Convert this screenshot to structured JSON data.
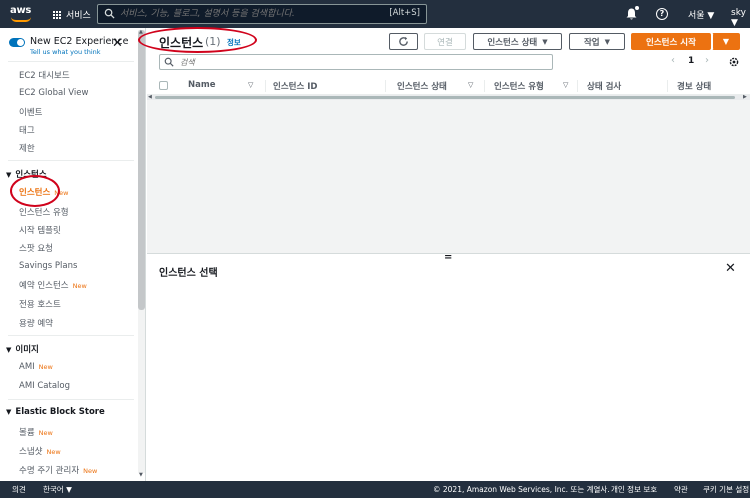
{
  "topnav": {
    "logo": "aws",
    "services_label": "서비스",
    "search_placeholder": "서비스, 기능, 블로그, 설명서 등을 검색합니다.",
    "search_shortcut": "[Alt+S]",
    "help_label": "?",
    "region": "서울 ▼",
    "user": "sky ▼"
  },
  "sidebar": {
    "experience_title": "New EC2 Experience",
    "experience_sub": "Tell us what you think",
    "new_badge": "New",
    "items": [
      {
        "label": "EC2 대시보드"
      },
      {
        "label": "EC2 Global View"
      },
      {
        "label": "이벤트"
      },
      {
        "label": "태그"
      },
      {
        "label": "제한"
      }
    ],
    "instances_section": "인스턴스",
    "instances_items": [
      {
        "label": "인스턴스",
        "new": true,
        "active": true
      },
      {
        "label": "인스턴스 유형"
      },
      {
        "label": "시작 템플릿"
      },
      {
        "label": "스팟 요청"
      },
      {
        "label": "Savings Plans"
      },
      {
        "label": "예약 인스턴스",
        "new": true
      },
      {
        "label": "전용 호스트"
      },
      {
        "label": "용량 예약"
      }
    ],
    "images_section": "이미지",
    "images_items": [
      {
        "label": "AMI",
        "new": true
      },
      {
        "label": "AMI Catalog"
      }
    ],
    "ebs_section": "Elastic Block Store",
    "ebs_items": [
      {
        "label": "볼륨",
        "new": true
      },
      {
        "label": "스냅샷",
        "new": true
      },
      {
        "label": "수명 주기 관리자",
        "new": true
      }
    ]
  },
  "main": {
    "title": "인스턴스",
    "count": "(1)",
    "info": "정보",
    "connect_label": "연결",
    "state_label": "인스턴스 상태",
    "actions_label": "작업",
    "launch_label": "인스턴스 시작",
    "search_placeholder": "검색",
    "page_number": "1",
    "columns": [
      "Name",
      "인스턴스 ID",
      "인스턴스 상태",
      "인스턴스 유형",
      "상태 검사",
      "경보 상태"
    ],
    "detail_title": "인스턴스 선택"
  },
  "footer": {
    "feedback": "의견",
    "language": "한국어 ▼",
    "copyright": "© 2021, Amazon Web Services, Inc. 또는 계열사.",
    "privacy": "개인 정보 보호",
    "terms": "약관",
    "cookies": "쿠키 기본 설정"
  },
  "colors": {
    "nav_bg": "#232f3e",
    "accent_orange": "#ec7211",
    "link_blue": "#0073bb",
    "annotation_red": "#d0021b"
  }
}
